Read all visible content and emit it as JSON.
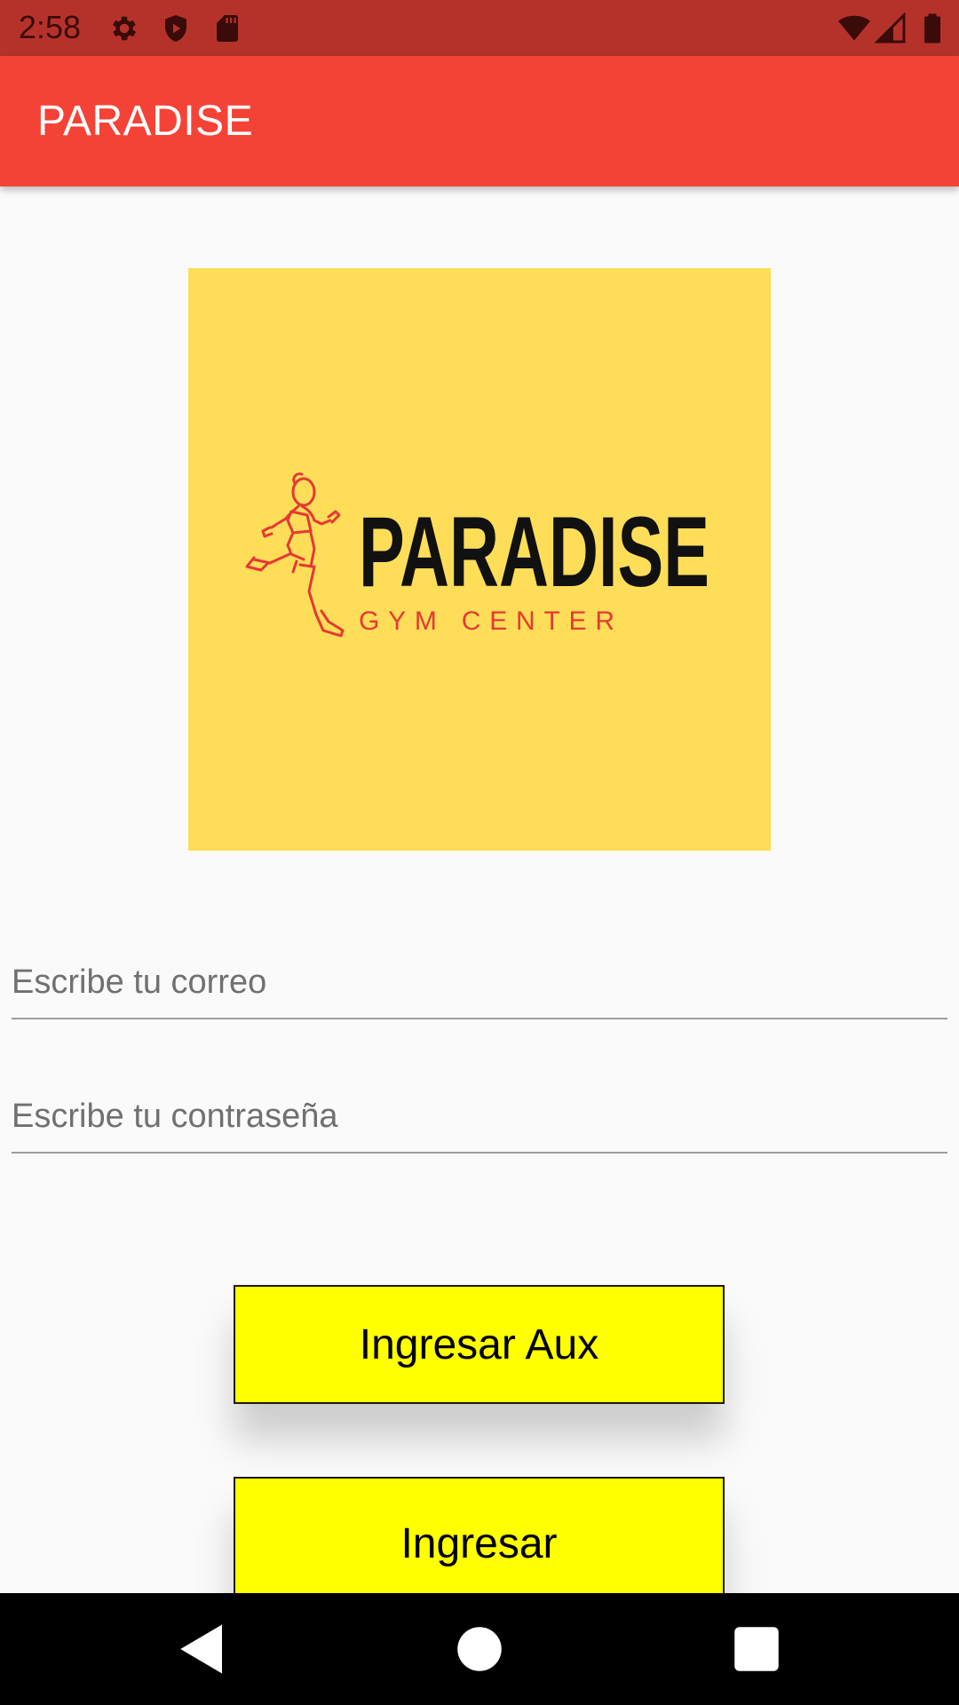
{
  "status_bar": {
    "time": "2:58",
    "bg_color": "#b5322b",
    "left_icons": [
      "gear-icon",
      "shield-icon",
      "sd-card-icon"
    ],
    "right_icons": [
      "wifi-icon",
      "signal-icon",
      "battery-icon"
    ]
  },
  "app_bar": {
    "title": "PARADISE",
    "bg_color": "#f44336"
  },
  "logo": {
    "bg_color": "#fedd58",
    "title": "PARADISE",
    "subtitle": "GYM CENTER",
    "icon": "runner-icon"
  },
  "form": {
    "email_placeholder": "Escribe tu correo",
    "email_value": "",
    "password_placeholder": "Escribe tu contraseña",
    "password_value": ""
  },
  "buttons": {
    "login_aux_label": "Ingresar Aux",
    "login_label": "Ingresar",
    "bg_color": "#ffff00"
  },
  "nav_bar": {
    "icons": [
      "back-icon",
      "home-icon",
      "recents-icon"
    ]
  }
}
